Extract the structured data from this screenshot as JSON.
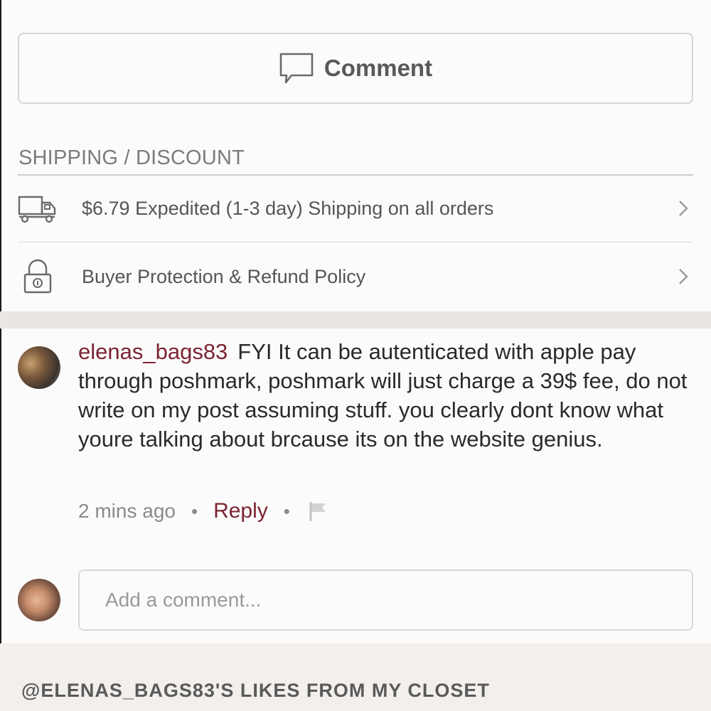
{
  "comment_button": {
    "label": "Comment",
    "icon": "speech-bubble-icon"
  },
  "shipping_section": {
    "title": "SHIPPING / DISCOUNT",
    "rows": [
      {
        "icon": "truck-icon",
        "text": "$6.79 Expedited (1-3 day) Shipping on all orders"
      },
      {
        "icon": "lock-icon",
        "text": "Buyer Protection & Refund Policy"
      }
    ]
  },
  "comment": {
    "username": "elenas_bags83",
    "text": "FYI It can be autenticated with apple pay through poshmark, poshmark will just charge a 39$ fee, do not write on my post assuming stuff. you clearly dont know what youre talking about brcause its on the website genius.",
    "time": "2 mins ago",
    "reply_label": "Reply",
    "separator": "•"
  },
  "add_comment": {
    "placeholder": "Add a comment..."
  },
  "likes_section": {
    "title": "@ELENAS_BAGS83'S LIKES FROM MY CLOSET"
  },
  "colors": {
    "accent": "#7a2431",
    "text_gray": "#555555",
    "border": "#d8d5d3",
    "band": "#e9e6e3"
  }
}
